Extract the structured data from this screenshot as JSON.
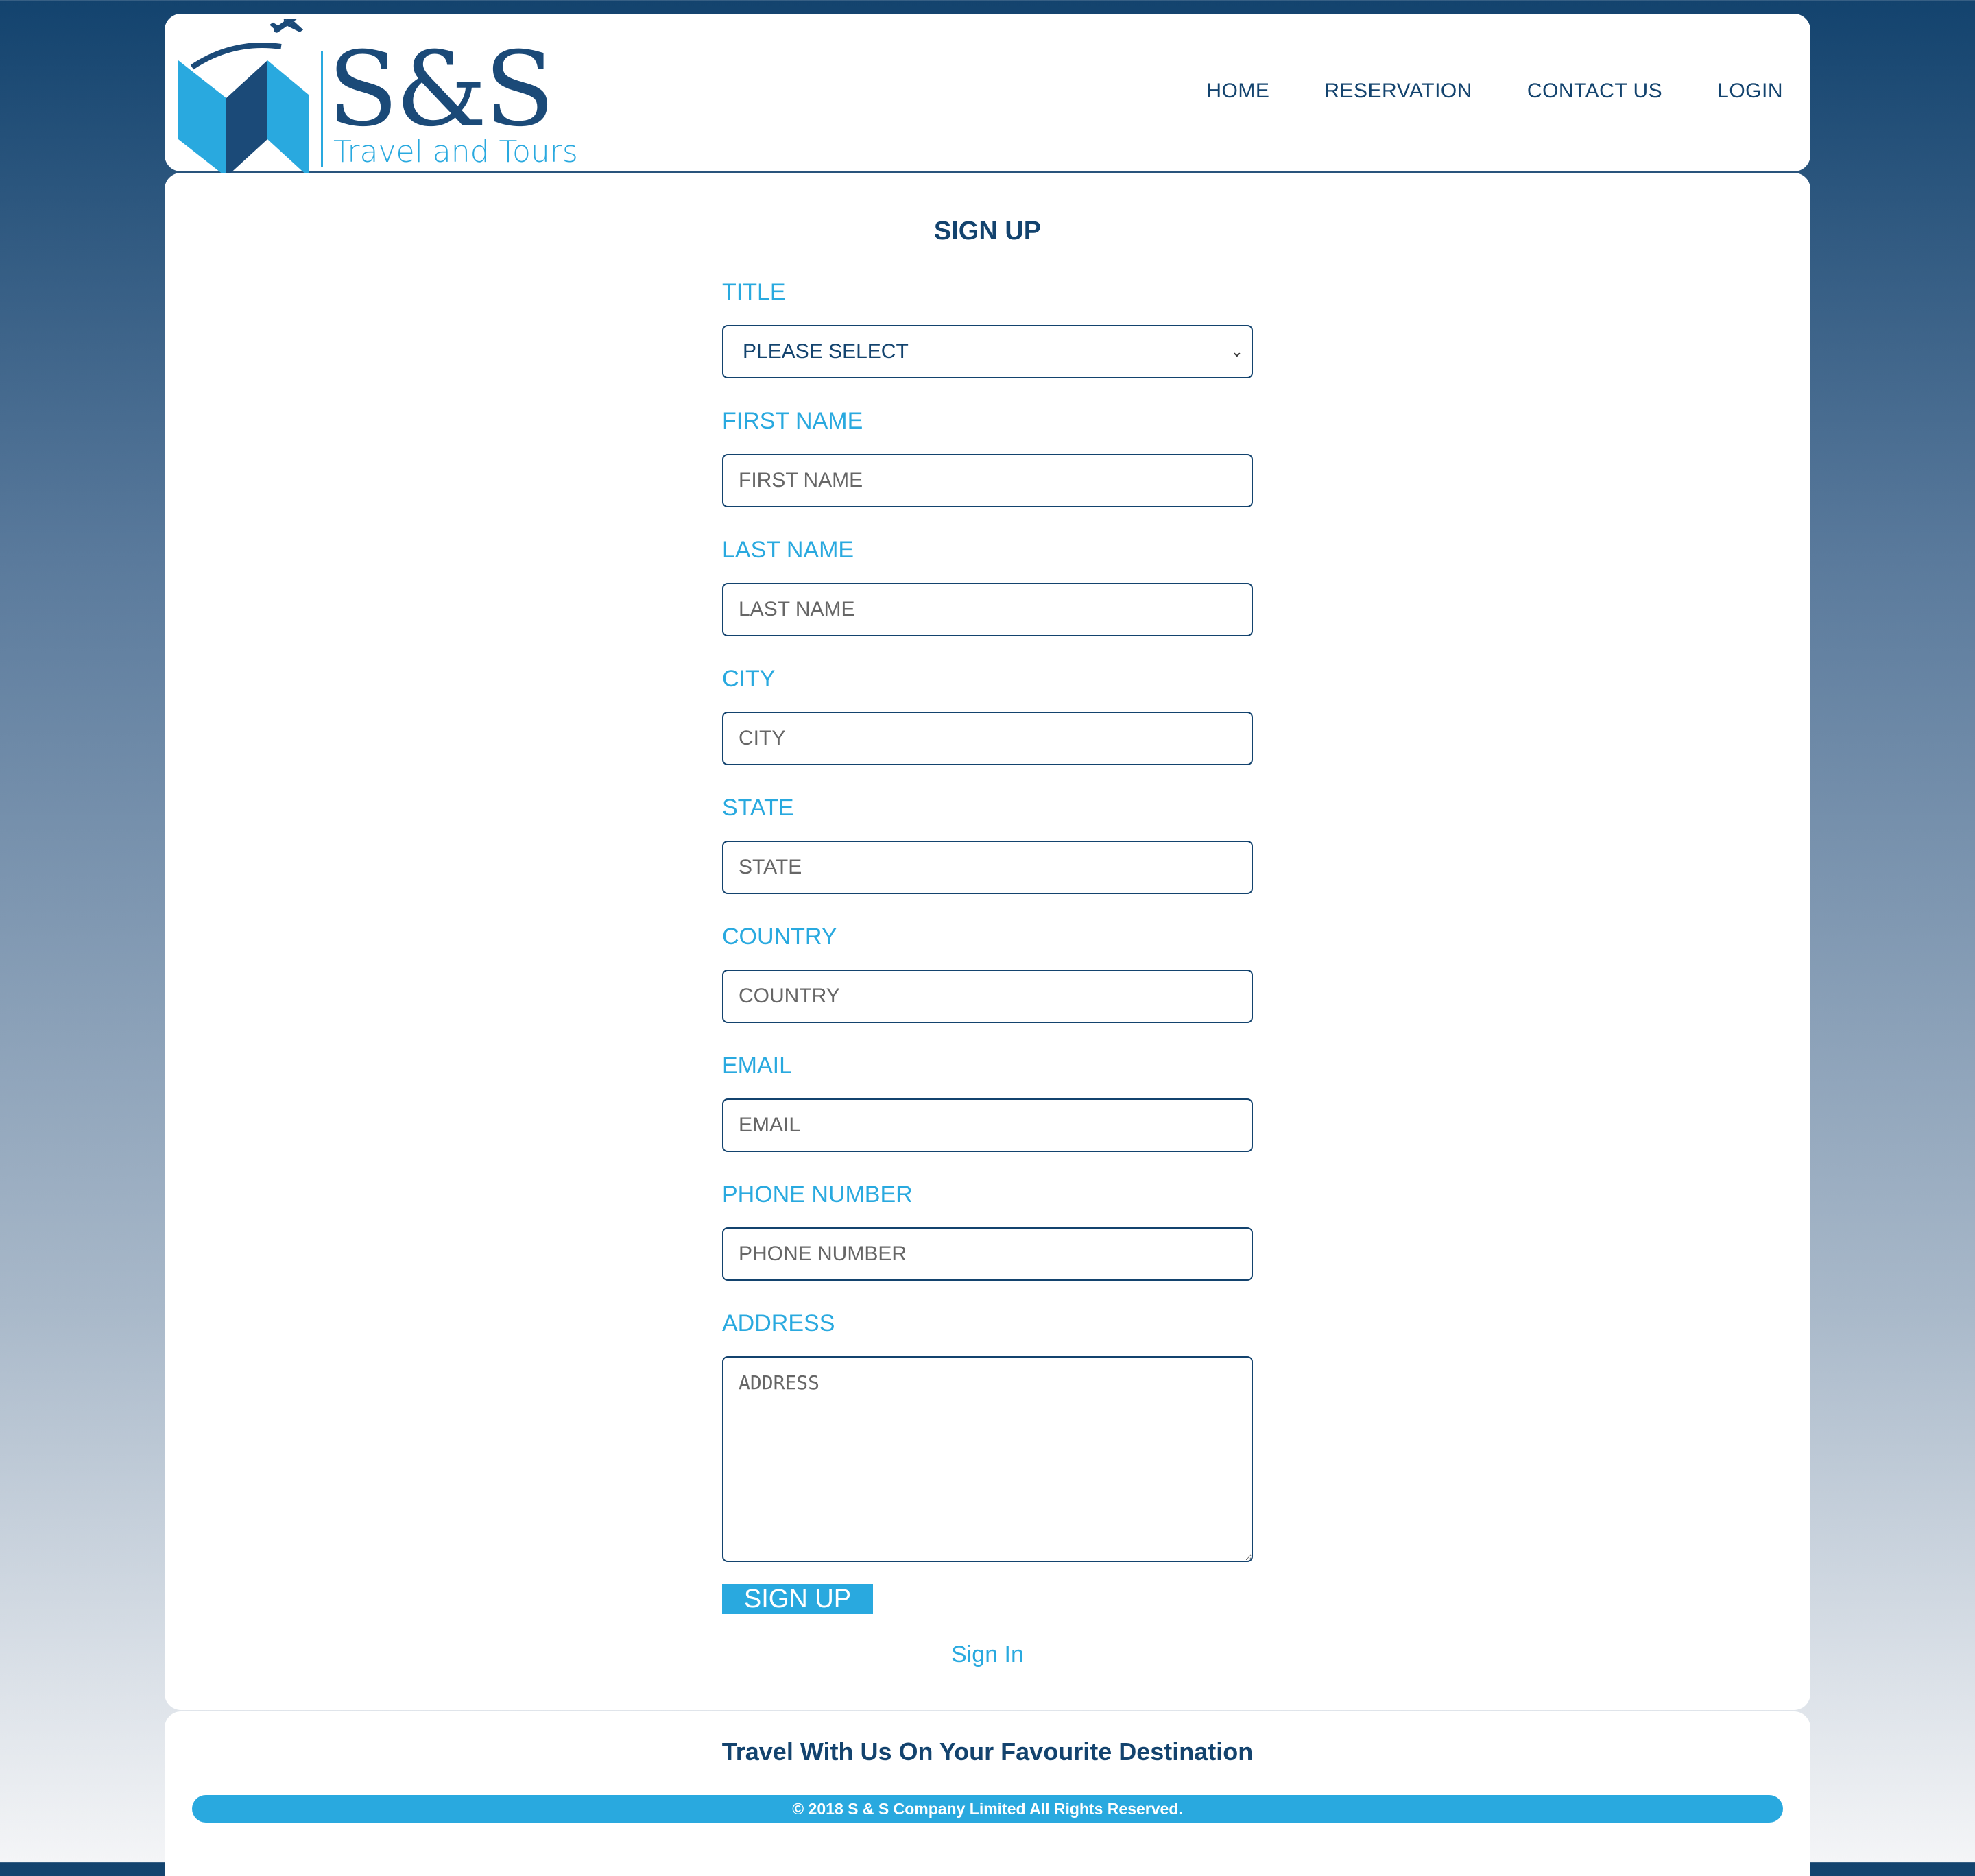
{
  "brand": {
    "name": "S&S",
    "tagline": "Travel and Tours",
    "colors": {
      "primary": "#13436e",
      "accent": "#29a9df"
    }
  },
  "nav": {
    "items": [
      {
        "label": "HOME"
      },
      {
        "label": "RESERVATION"
      },
      {
        "label": "CONTACT US"
      },
      {
        "label": "LOGIN"
      }
    ]
  },
  "form": {
    "title": "SIGN UP",
    "title_field": {
      "label": "TITLE",
      "value": "PLEASE SELECT"
    },
    "first_name": {
      "label": "FIRST NAME",
      "placeholder": "FIRST NAME"
    },
    "last_name": {
      "label": "LAST NAME",
      "placeholder": "LAST NAME"
    },
    "city": {
      "label": "CITY",
      "placeholder": "CITY"
    },
    "state": {
      "label": "STATE",
      "placeholder": "STATE"
    },
    "country": {
      "label": "COUNTRY",
      "placeholder": "COUNTRY"
    },
    "email": {
      "label": "EMAIL",
      "placeholder": "EMAIL"
    },
    "phone": {
      "label": "PHONE NUMBER",
      "placeholder": "PHONE NUMBER"
    },
    "address": {
      "label": "ADDRESS",
      "placeholder": "ADDRESS"
    },
    "submit_label": "SIGN UP",
    "signin_link": "Sign In"
  },
  "footer": {
    "tagline": "Travel With Us On Your Favourite Destination",
    "copyright": "© 2018 S & S Company Limited All Rights Reserved."
  }
}
